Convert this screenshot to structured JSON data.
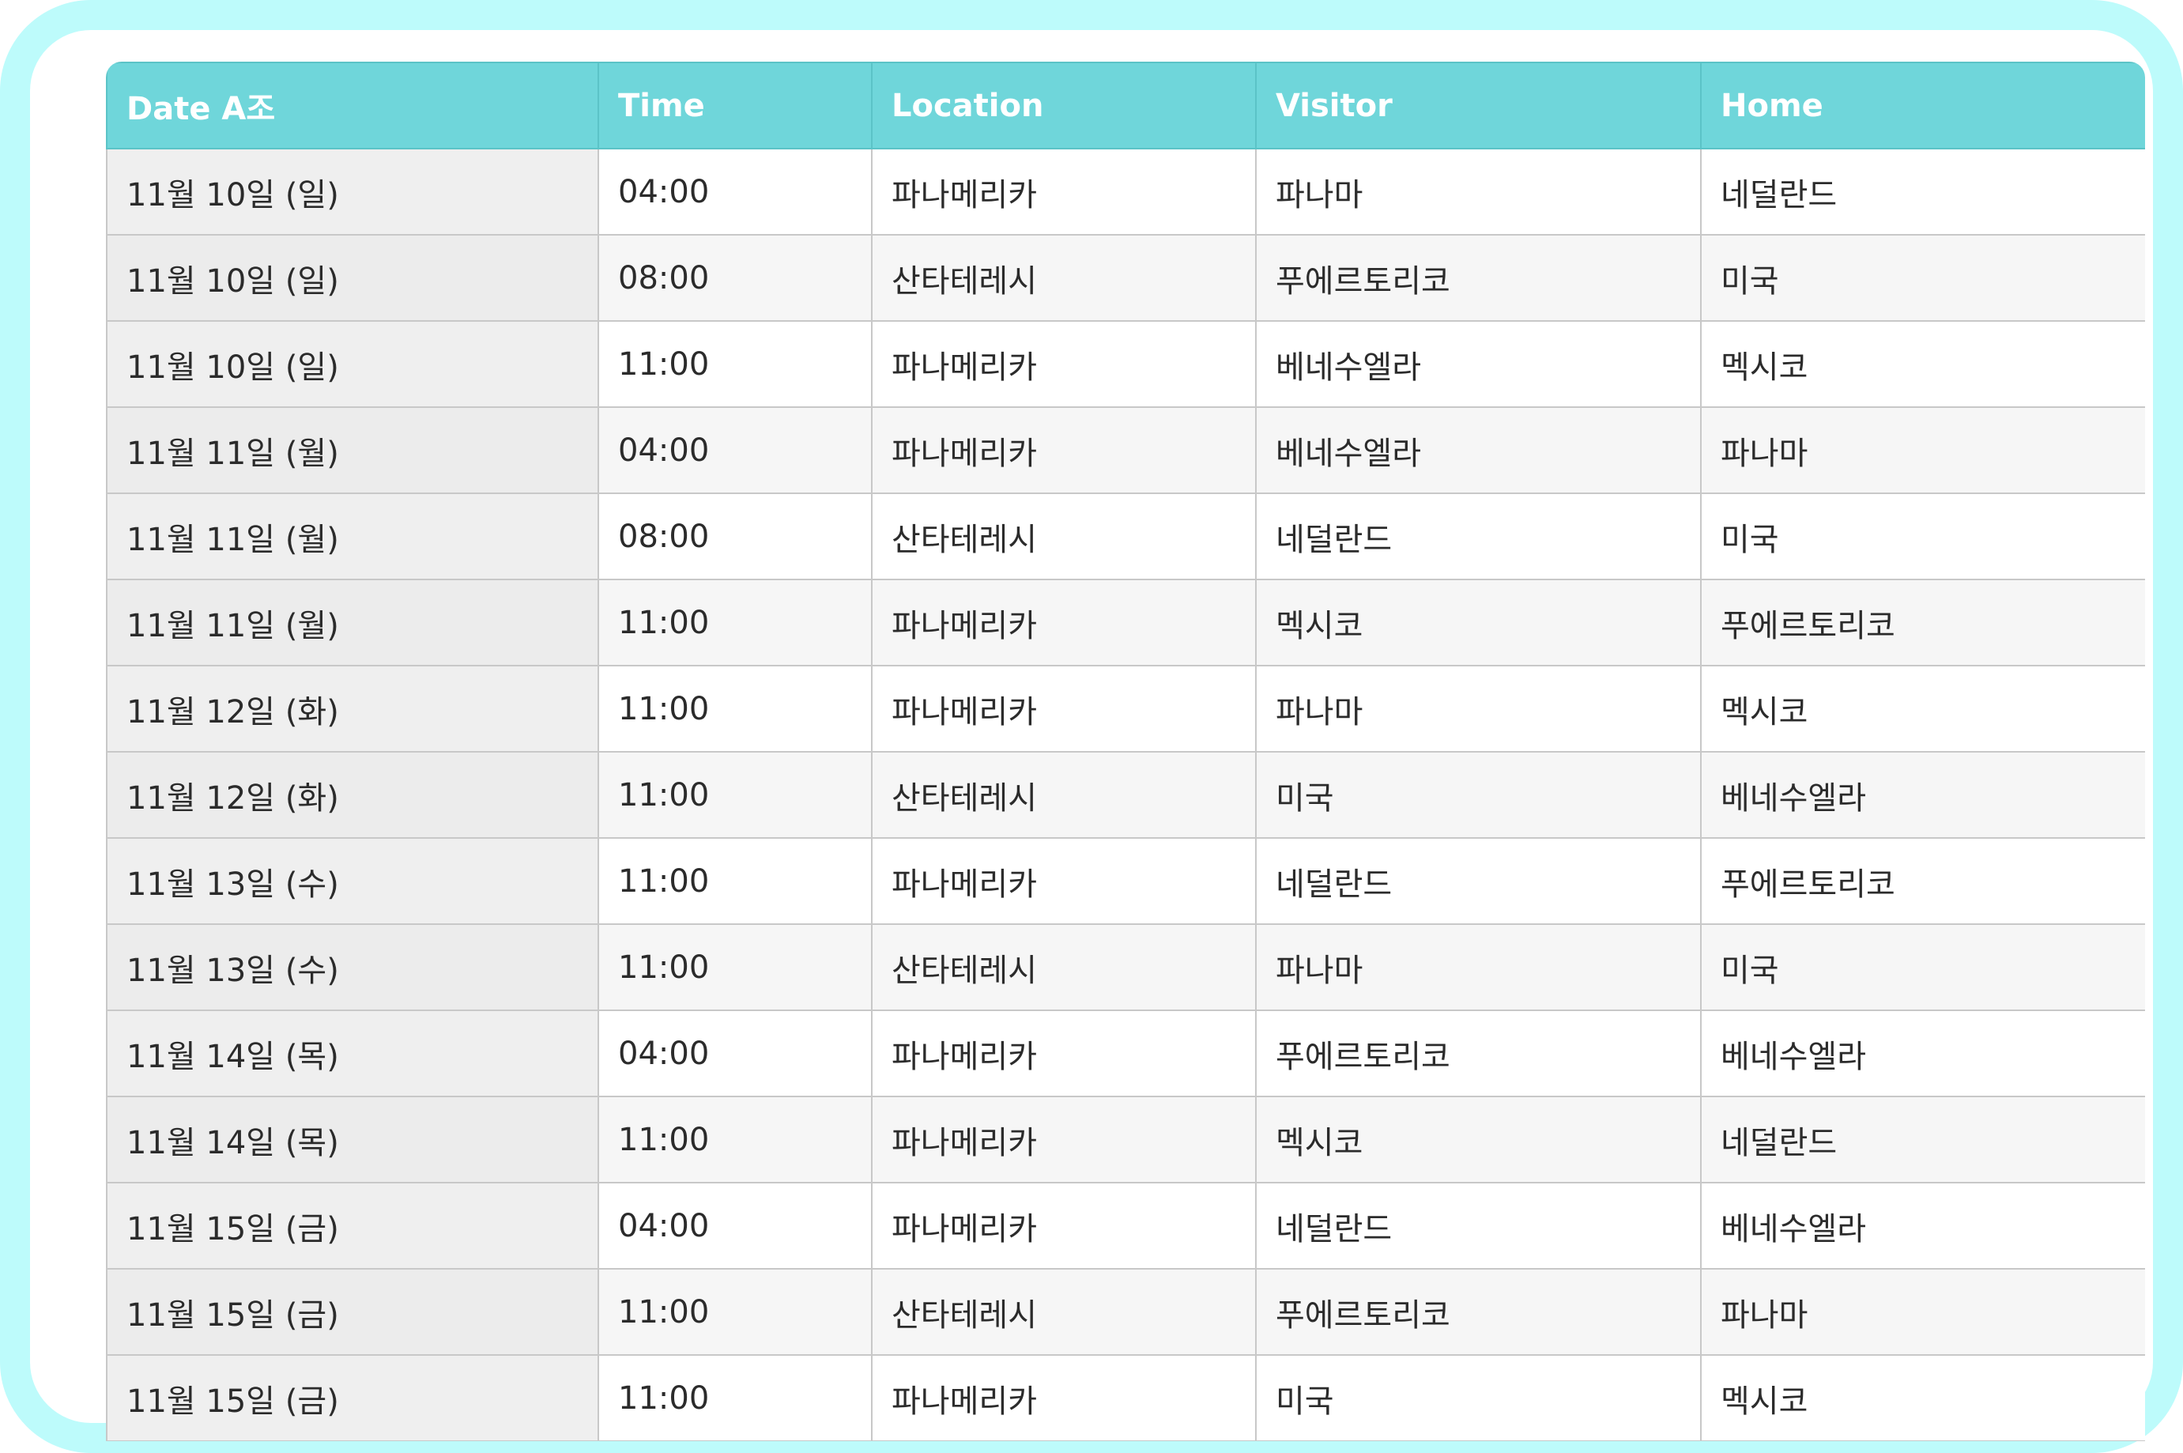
{
  "table": {
    "headers": [
      "Date A조",
      "Time",
      "Location",
      "Visitor",
      "Home"
    ],
    "rows": [
      [
        "11월 10일 (일)",
        "04:00",
        "파나메리카",
        "파나마",
        "네덜란드"
      ],
      [
        "11월 10일 (일)",
        "08:00",
        "산타테레시",
        "푸에르토리코",
        "미국"
      ],
      [
        "11월 10일 (일)",
        "11:00",
        "파나메리카",
        "베네수엘라",
        "멕시코"
      ],
      [
        "11월 11일 (월)",
        "04:00",
        "파나메리카",
        "베네수엘라",
        "파나마"
      ],
      [
        "11월 11일 (월)",
        "08:00",
        "산타테레시",
        "네덜란드",
        "미국"
      ],
      [
        "11월 11일 (월)",
        "11:00",
        "파나메리카",
        "멕시코",
        "푸에르토리코"
      ],
      [
        "11월 12일 (화)",
        "11:00",
        "파나메리카",
        "파나마",
        "멕시코"
      ],
      [
        "11월 12일 (화)",
        "11:00",
        "산타테레시",
        "미국",
        "베네수엘라"
      ],
      [
        "11월 13일 (수)",
        "11:00",
        "파나메리카",
        "네덜란드",
        "푸에르토리코"
      ],
      [
        "11월 13일 (수)",
        "11:00",
        "산타테레시",
        "파나마",
        "미국"
      ],
      [
        "11월 14일 (목)",
        "04:00",
        "파나메리카",
        "푸에르토리코",
        "베네수엘라"
      ],
      [
        "11월 14일 (목)",
        "11:00",
        "파나메리카",
        "멕시코",
        "네덜란드"
      ],
      [
        "11월 15일 (금)",
        "04:00",
        "파나메리카",
        "네덜란드",
        "베네수엘라"
      ],
      [
        "11월 15일 (금)",
        "11:00",
        "산타테레시",
        "푸에르토리코",
        "파나마"
      ],
      [
        "11월 15일 (금)",
        "11:00",
        "파나메리카",
        "미국",
        "멕시코"
      ]
    ]
  }
}
